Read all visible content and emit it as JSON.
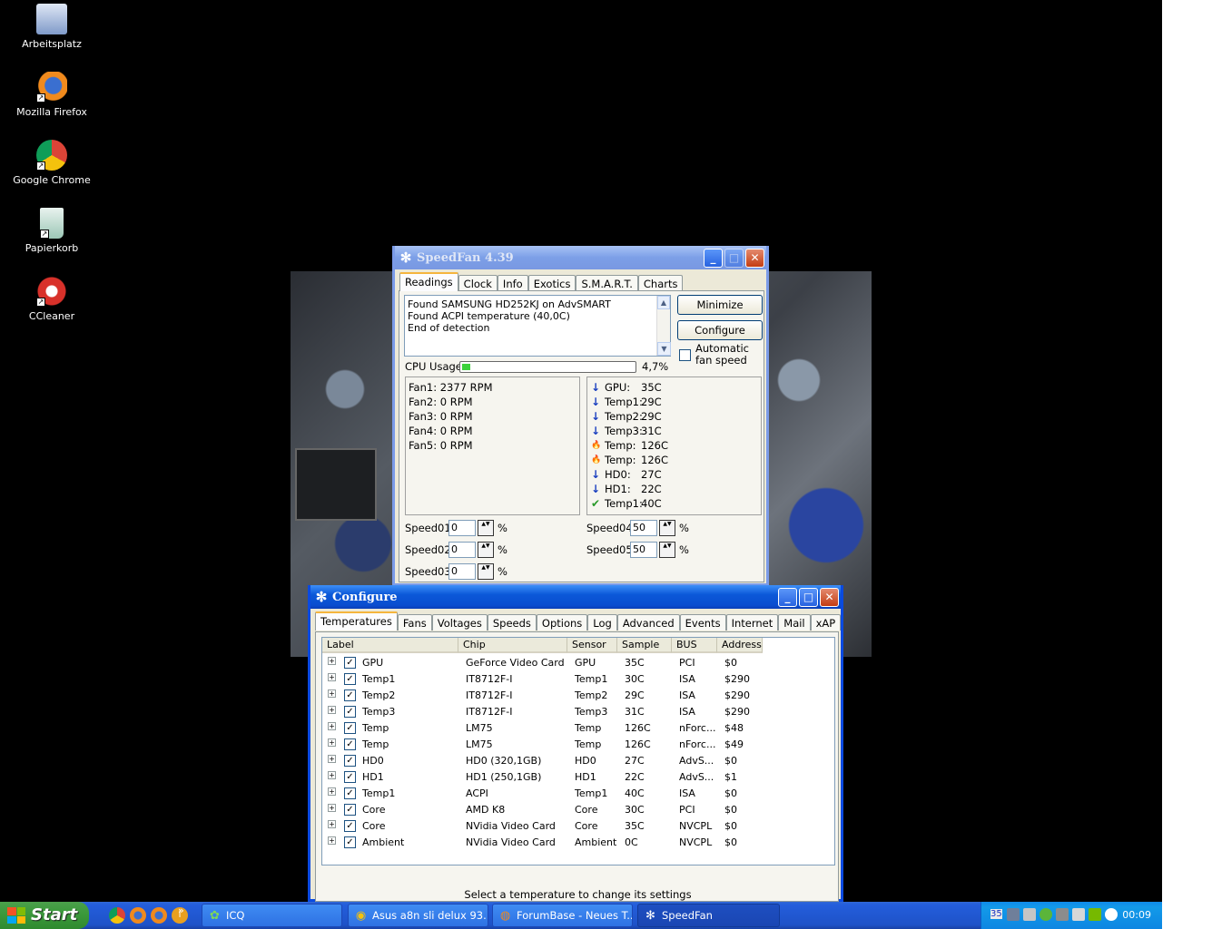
{
  "desktop": {
    "icons": [
      {
        "label": "Arbeitsplatz",
        "icon": "my-computer-icon"
      },
      {
        "label": "Mozilla Firefox",
        "icon": "firefox-icon"
      },
      {
        "label": "Google Chrome",
        "icon": "chrome-icon"
      },
      {
        "label": "Papierkorb",
        "icon": "recycle-bin-icon"
      },
      {
        "label": "CCleaner",
        "icon": "ccleaner-icon"
      }
    ]
  },
  "speedfan": {
    "title": "SpeedFan 4.39",
    "tabs": [
      "Readings",
      "Clock",
      "Info",
      "Exotics",
      "S.M.A.R.T.",
      "Charts"
    ],
    "log_lines": [
      "Found SAMSUNG HD252KJ on AdvSMART",
      "Found ACPI temperature (40,0C)",
      "End of detection"
    ],
    "minimize_label": "Minimize",
    "configure_label": "Configure",
    "auto_fan_label": "Automatic fan speed",
    "auto_fan_checked": false,
    "cpu_usage_label": "CPU Usage",
    "cpu_usage_value": "4,7%",
    "cpu_usage_fraction": 0.047,
    "fans": [
      "Fan1: 2377 RPM",
      "Fan2: 0 RPM",
      "Fan3: 0 RPM",
      "Fan4: 0 RPM",
      "Fan5: 0 RPM"
    ],
    "temps": [
      {
        "status": "down",
        "label": "GPU:",
        "value": "35C"
      },
      {
        "status": "down",
        "label": "Temp1:",
        "value": "29C"
      },
      {
        "status": "down",
        "label": "Temp2:",
        "value": "29C"
      },
      {
        "status": "down",
        "label": "Temp3:",
        "value": "31C"
      },
      {
        "status": "fire",
        "label": "Temp:",
        "value": "126C"
      },
      {
        "status": "fire",
        "label": "Temp:",
        "value": "126C"
      },
      {
        "status": "down",
        "label": "HD0:",
        "value": "27C"
      },
      {
        "status": "down",
        "label": "HD1:",
        "value": "22C"
      },
      {
        "status": "ok",
        "label": "Temp1:",
        "value": "40C"
      }
    ],
    "speeds_left": [
      {
        "label": "Speed01:",
        "value": "0",
        "unit": "%"
      },
      {
        "label": "Speed02:",
        "value": "0",
        "unit": "%"
      },
      {
        "label": "Speed03:",
        "value": "0",
        "unit": "%"
      }
    ],
    "speeds_right": [
      {
        "label": "Speed04:",
        "value": "50",
        "unit": "%"
      },
      {
        "label": "Speed05:",
        "value": "50",
        "unit": "%"
      }
    ]
  },
  "configure": {
    "title": "Configure",
    "tabs": [
      "Temperatures",
      "Fans",
      "Voltages",
      "Speeds",
      "Options",
      "Log",
      "Advanced",
      "Events",
      "Internet",
      "Mail",
      "xAP"
    ],
    "columns": [
      "Label",
      "Chip",
      "Sensor",
      "Sample",
      "BUS",
      "Address"
    ],
    "rows": [
      {
        "label": "GPU",
        "chip": "GeForce Video Card",
        "sensor": "GPU",
        "sample": "35C",
        "bus": "PCI",
        "address": "$0"
      },
      {
        "label": "Temp1",
        "chip": "IT8712F-I",
        "sensor": "Temp1",
        "sample": "30C",
        "bus": "ISA",
        "address": "$290"
      },
      {
        "label": "Temp2",
        "chip": "IT8712F-I",
        "sensor": "Temp2",
        "sample": "29C",
        "bus": "ISA",
        "address": "$290"
      },
      {
        "label": "Temp3",
        "chip": "IT8712F-I",
        "sensor": "Temp3",
        "sample": "31C",
        "bus": "ISA",
        "address": "$290"
      },
      {
        "label": "Temp",
        "chip": "LM75",
        "sensor": "Temp",
        "sample": "126C",
        "bus": "nForc...",
        "address": "$48"
      },
      {
        "label": "Temp",
        "chip": "LM75",
        "sensor": "Temp",
        "sample": "126C",
        "bus": "nForc...",
        "address": "$49"
      },
      {
        "label": "HD0",
        "chip": "HD0 (320,1GB)",
        "sensor": "HD0",
        "sample": "27C",
        "bus": "AdvS...",
        "address": "$0"
      },
      {
        "label": "HD1",
        "chip": "HD1 (250,1GB)",
        "sensor": "HD1",
        "sample": "22C",
        "bus": "AdvS...",
        "address": "$1"
      },
      {
        "label": "Temp1",
        "chip": "ACPI",
        "sensor": "Temp1",
        "sample": "40C",
        "bus": "ISA",
        "address": "$0"
      },
      {
        "label": "Core",
        "chip": "AMD K8",
        "sensor": "Core",
        "sample": "30C",
        "bus": "PCI",
        "address": "$0"
      },
      {
        "label": "Core",
        "chip": "NVidia Video Card",
        "sensor": "Core",
        "sample": "35C",
        "bus": "NVCPL",
        "address": "$0"
      },
      {
        "label": "Ambient",
        "chip": "NVidia Video Card",
        "sensor": "Ambient",
        "sample": "0C",
        "bus": "NVCPL",
        "address": "$0"
      }
    ],
    "hint": "Select a temperature to change its settings"
  },
  "taskbar": {
    "start_label": "Start",
    "quicklaunch": [
      "chrome-icon",
      "firefox-icon",
      "firefox-icon",
      "info-icon"
    ],
    "expand": "»",
    "tasks": [
      {
        "label": "ICQ",
        "icon": "icq-icon"
      },
      {
        "label": "Asus a8n sli delux 93...",
        "icon": "chrome-icon"
      },
      {
        "label": "ForumBase - Neues T...",
        "icon": "firefox-icon"
      },
      {
        "label": "SpeedFan",
        "icon": "speedfan-icon"
      }
    ],
    "tray_number": "35",
    "clock": "00:09"
  },
  "colors": {
    "xp_blue": "#0a4ae0",
    "progress_green": "#3bd23b",
    "tab_highlight": "#f5b53d"
  }
}
